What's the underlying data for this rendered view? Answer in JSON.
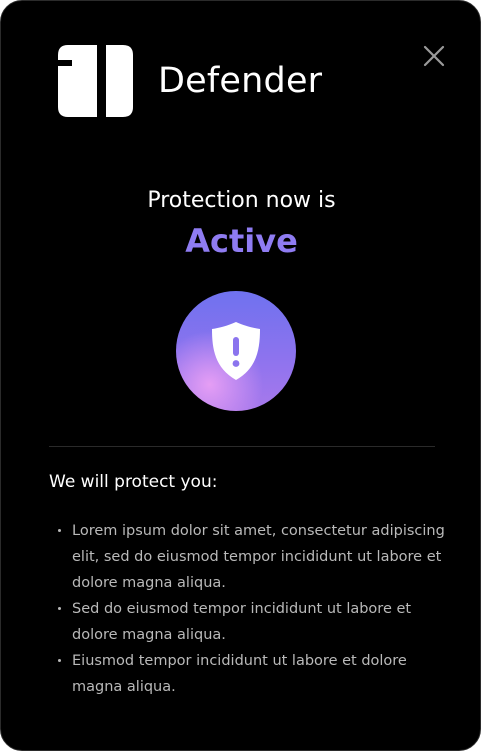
{
  "app": {
    "title": "Defender",
    "logo_icon": "defender-logo-icon",
    "close_icon": "close-icon"
  },
  "status": {
    "line": "Protection now is",
    "value": "Active",
    "icon": "shield-exclamation-icon"
  },
  "colors": {
    "background": "#000000",
    "accent": "#8f7cf2",
    "text_primary": "#ffffff",
    "text_secondary": "#b9b9b9"
  },
  "protection": {
    "heading": "We will protect you:",
    "items": [
      "Lorem ipsum dolor sit amet, consectetur adipiscing elit, sed do eiusmod tempor incididunt ut labore et dolore magna aliqua.",
      "Sed do eiusmod tempor incididunt ut labore et dolore magna aliqua.",
      "Eiusmod tempor incididunt ut labore et dolore magna aliqua."
    ]
  }
}
